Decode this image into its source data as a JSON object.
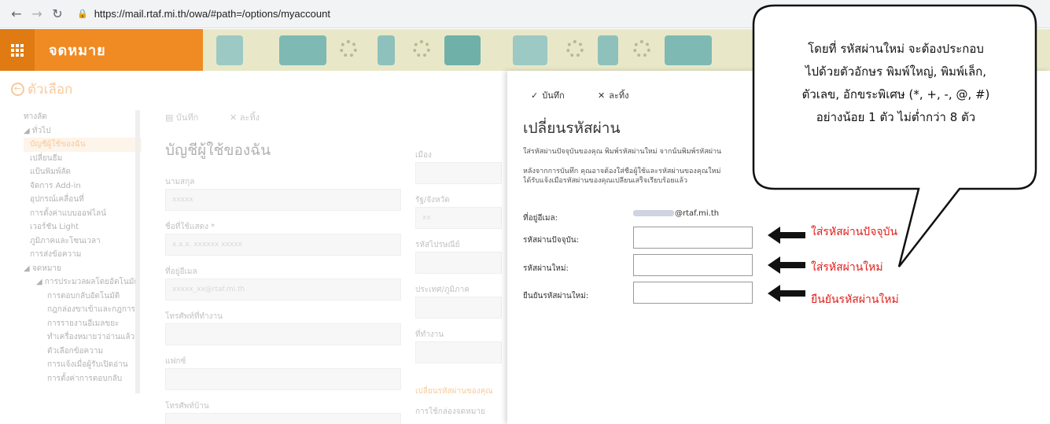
{
  "browser": {
    "url": "https://mail.rtaf.mi.th/owa/#path=/options/myaccount"
  },
  "header": {
    "app_name": "จดหมาย"
  },
  "options": {
    "back_title": "ตัวเลือก",
    "nav": [
      {
        "label": "ทางลัด",
        "level": 1,
        "active": false
      },
      {
        "label": "◢ ทั่วไป",
        "level": 1,
        "active": false
      },
      {
        "label": "บัญชีผู้ใช้ของฉัน",
        "level": 2,
        "active": true
      },
      {
        "label": "เปลี่ยนธีม",
        "level": 2,
        "active": false
      },
      {
        "label": "แป้นพิมพ์ลัด",
        "level": 2,
        "active": false
      },
      {
        "label": "จัดการ Add-in",
        "level": 2,
        "active": false
      },
      {
        "label": "อุปกรณ์เคลื่อนที่",
        "level": 2,
        "active": false
      },
      {
        "label": "การตั้งค่าแบบออฟไลน์",
        "level": 2,
        "active": false
      },
      {
        "label": "เวอร์ชัน Light",
        "level": 2,
        "active": false
      },
      {
        "label": "ภูมิภาคและโซนเวลา",
        "level": 2,
        "active": false
      },
      {
        "label": "การส่งข้อความ",
        "level": 2,
        "active": false
      },
      {
        "label": "◢ จดหมาย",
        "level": 1,
        "active": false
      },
      {
        "label": "◢ การประมวลผลโดยอัตโนมัติ",
        "level": 3,
        "active": false
      },
      {
        "label": "การตอบกลับอัตโนมัติ",
        "level": 4,
        "active": false
      },
      {
        "label": "กฎกล่องขาเข้าและกฎการ",
        "level": 4,
        "active": false
      },
      {
        "label": "การรายงานอีเมลขยะ",
        "level": 4,
        "active": false
      },
      {
        "label": "ทำเครื่องหมายว่าอ่านแล้ว",
        "level": 4,
        "active": false
      },
      {
        "label": "ตัวเลือกข้อความ",
        "level": 4,
        "active": false
      },
      {
        "label": "การแจ้งเมื่อผู้รับเปิดอ่าน",
        "level": 4,
        "active": false
      },
      {
        "label": "การตั้งค่าการตอบกลับ",
        "level": 4,
        "active": false
      }
    ],
    "toolbar": {
      "save": "บันทึก",
      "discard": "ละทิ้ง"
    },
    "page_title": "บัญชีผู้ใช้ของฉัน",
    "fields_left": [
      {
        "label": "นามสกุล",
        "value": "xxxxx"
      },
      {
        "label": "ชื่อที่ใช้แสดง *",
        "value": "x.x.x. xxxxxx xxxxx"
      },
      {
        "label": "ที่อยู่อีเมล",
        "value": "xxxxx_xx@rtaf.mi.th"
      },
      {
        "label": "โทรศัพท์ที่ทำงาน",
        "value": ""
      },
      {
        "label": "แฟกซ์",
        "value": ""
      },
      {
        "label": "โทรศัพท์บ้าน",
        "value": ""
      }
    ],
    "fields_right": [
      {
        "label": "เมือง",
        "value": ""
      },
      {
        "label": "รัฐ/จังหวัด",
        "value": "xx"
      },
      {
        "label": "รหัสไปรษณีย์",
        "value": ""
      },
      {
        "label": "ประเทศ/ภูมิภาค",
        "value": ""
      },
      {
        "label": "ที่ทำงาน",
        "value": ""
      }
    ],
    "change_password_link": "เปลี่ยนรหัสผ่านของคุณ",
    "mailbox_usage_label": "การใช้กล่องจดหมาย"
  },
  "panel": {
    "save": "บันทึก",
    "discard": "ละทิ้ง",
    "title": "เปลี่ยนรหัสผ่าน",
    "desc1": "ใส่รหัสผ่านปัจจุบันของคุณ พิมพ์รหัสผ่านใหม่ จากนั้นพิมพ์รหัสผ่าน",
    "desc2a": "หลังจากการบันทึก คุณอาจต้องใส่ชื่อผู้ใช้และรหัสผ่านของคุณใหม่",
    "desc2b": "ได้รับแจ้งเมื่อรหัสผ่านของคุณเปลี่ยนเสร็จเรียบร้อยแล้ว",
    "email_label": "ที่อยู่อีเมล:",
    "email_domain": "@rtaf.mi.th",
    "current_label": "รหัสผ่านปัจจุบัน:",
    "new_label": "รหัสผ่านใหม่:",
    "confirm_label": "ยืนยันรหัสผ่านใหม่:",
    "current_value": "",
    "new_value": "",
    "confirm_value": ""
  },
  "annotations": {
    "current": "ใส่รหัสผ่านปัจจุบัน",
    "new": "ใส่รหัสผ่านใหม่",
    "confirm": "ยืนยันรหัสผ่านใหม่",
    "callout_lines": [
      "โดยที่ รหัสผ่านใหม่ จะต้องประกอบ",
      "ไปด้วยตัวอักษร พิมพ์ใหญ่, พิมพ์เล็ก,",
      "ตัวเลข, อักขระพิเศษ (*, +, -, @, #)",
      "อย่างน้อย 1 ตัว ไม่ต่ำกว่า 8 ตัว"
    ],
    "colors": {
      "annotation": "#e0201b",
      "accent": "#f08a22"
    }
  }
}
